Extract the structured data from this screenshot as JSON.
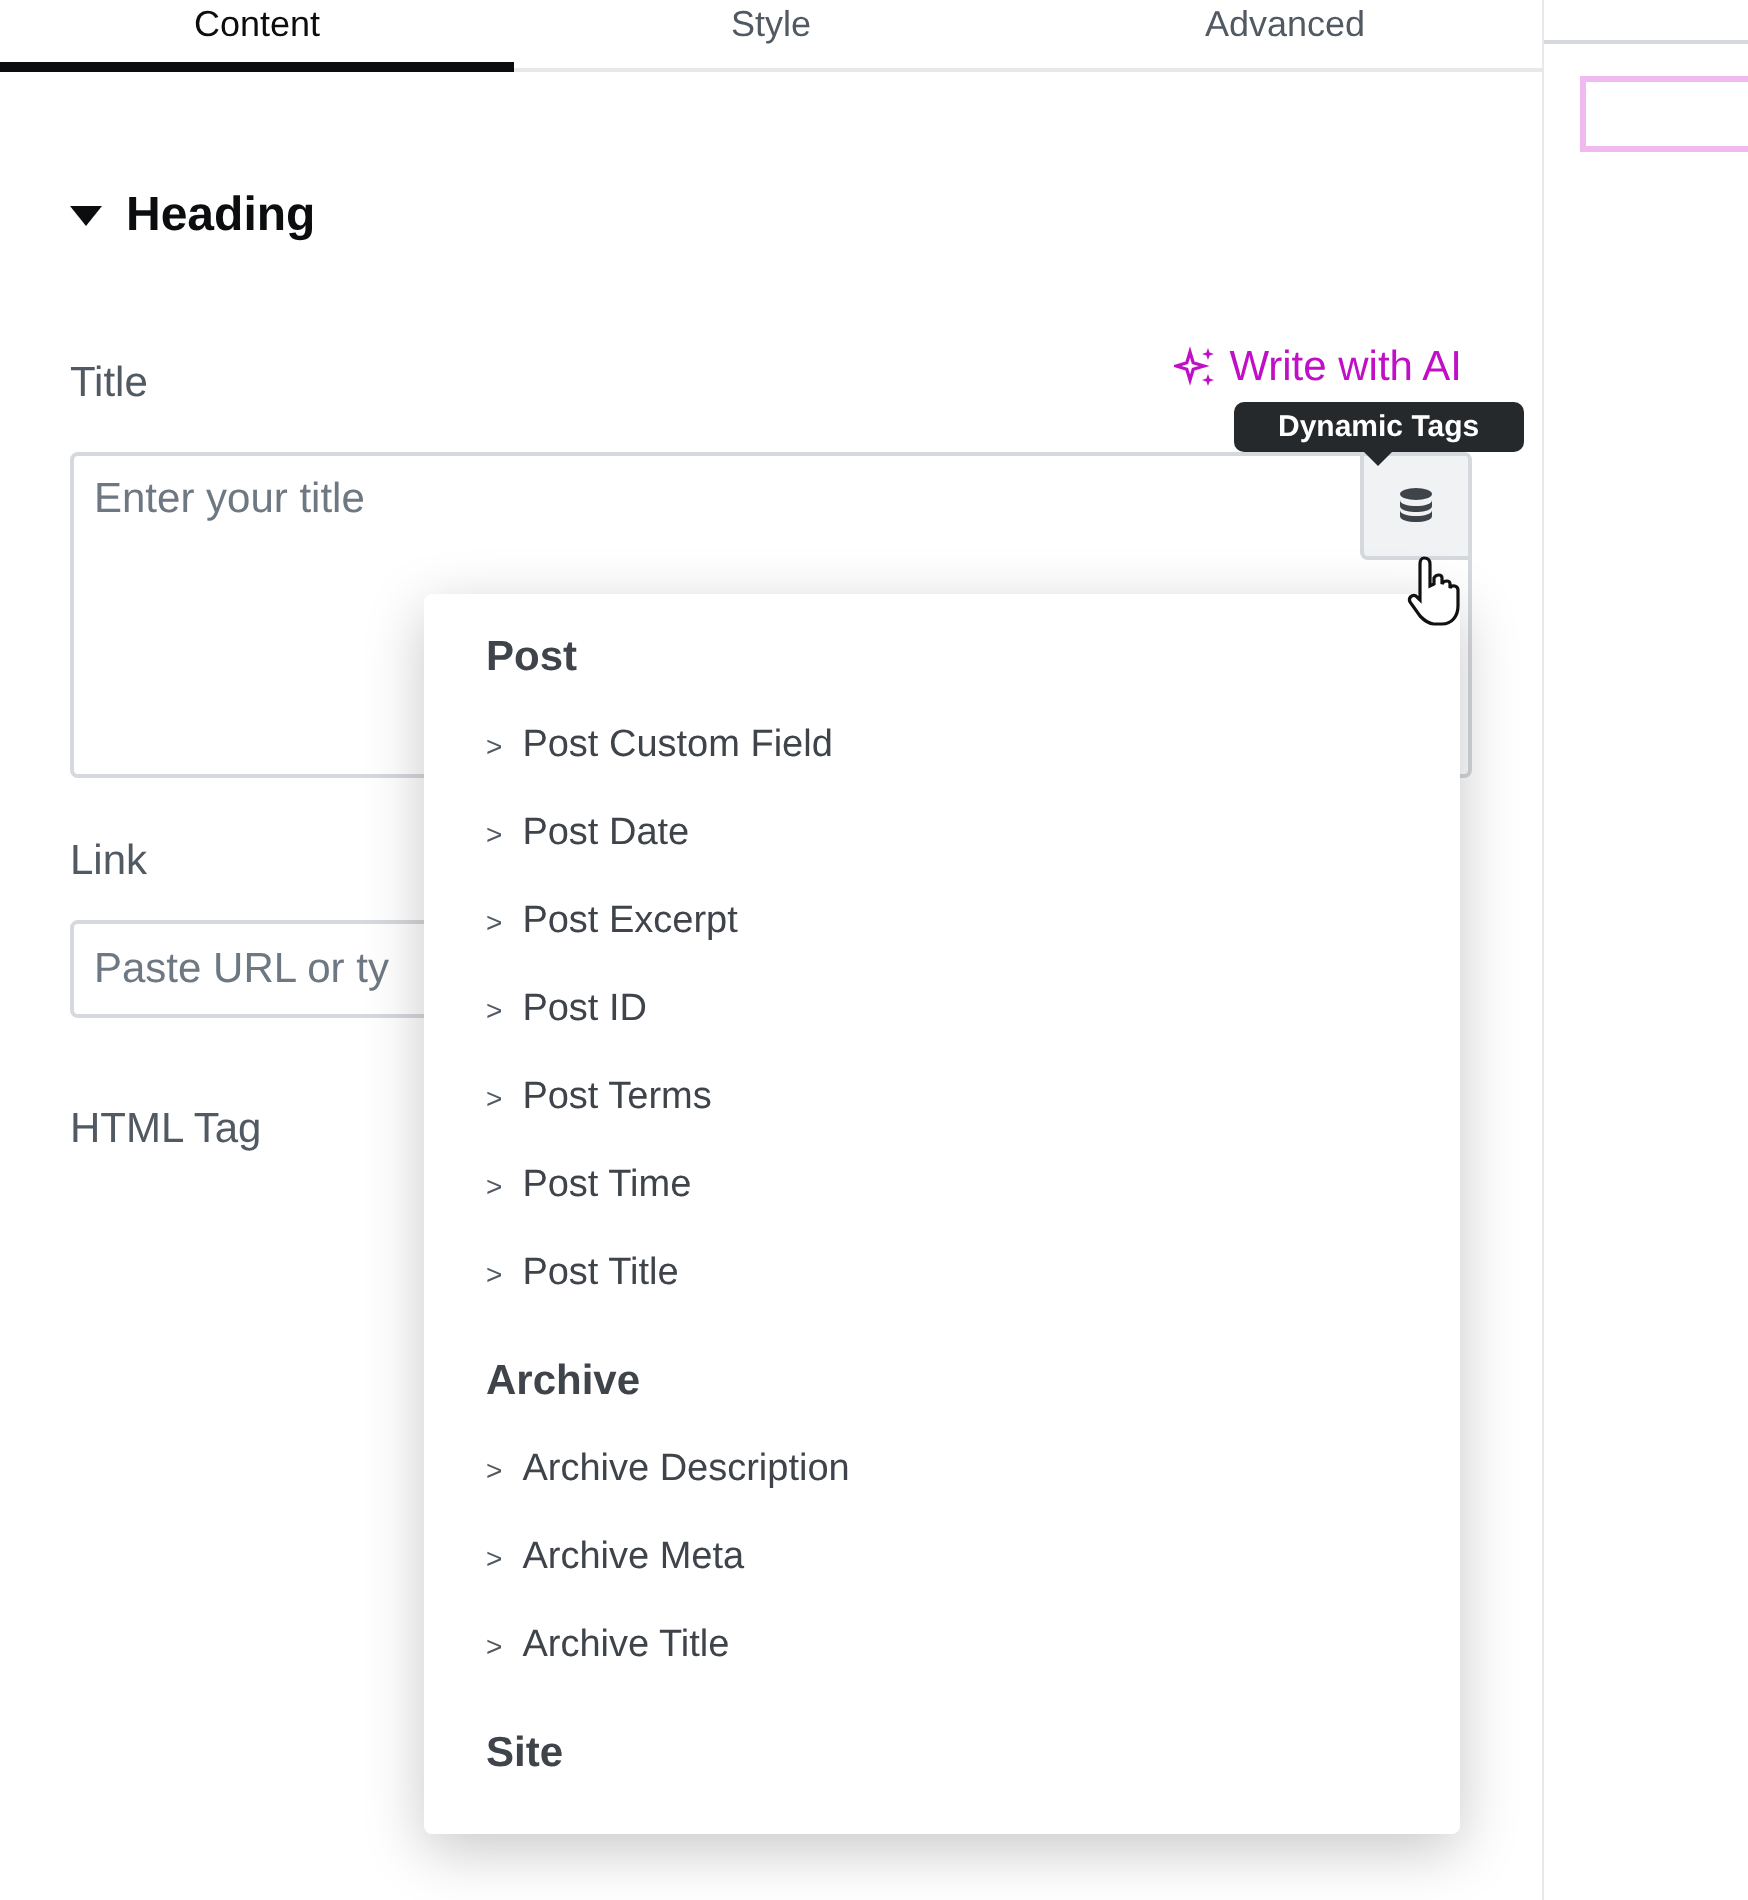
{
  "tabs": [
    {
      "label": "Content",
      "selected": true
    },
    {
      "label": "Style",
      "selected": false
    },
    {
      "label": "Advanced",
      "selected": false
    }
  ],
  "section": {
    "title": "Heading",
    "expanded": true
  },
  "title_field": {
    "label": "Title",
    "ai_link": "Write with AI",
    "placeholder": "Enter your title"
  },
  "tooltip": "Dynamic Tags",
  "link_field": {
    "label": "Link",
    "placeholder": "Paste URL or ty"
  },
  "html_tag": {
    "label": "HTML Tag"
  },
  "dropdown": {
    "groups": [
      {
        "title": "Post",
        "items": [
          {
            "marker": ">",
            "label": "Post Custom Field"
          },
          {
            "marker": ">",
            "label": "Post Date"
          },
          {
            "marker": ">",
            "label": "Post Excerpt"
          },
          {
            "marker": ">",
            "label": "Post ID"
          },
          {
            "marker": ">",
            "label": "Post Terms"
          },
          {
            "marker": ">",
            "label": "Post Time"
          },
          {
            "marker": ">",
            "label": "Post Title"
          }
        ]
      },
      {
        "title": "Archive",
        "items": [
          {
            "marker": ">",
            "label": "Archive Description"
          },
          {
            "marker": ">",
            "label": "Archive Meta"
          },
          {
            "marker": ">",
            "label": "Archive Title"
          }
        ]
      },
      {
        "title": "Site"
      }
    ]
  }
}
